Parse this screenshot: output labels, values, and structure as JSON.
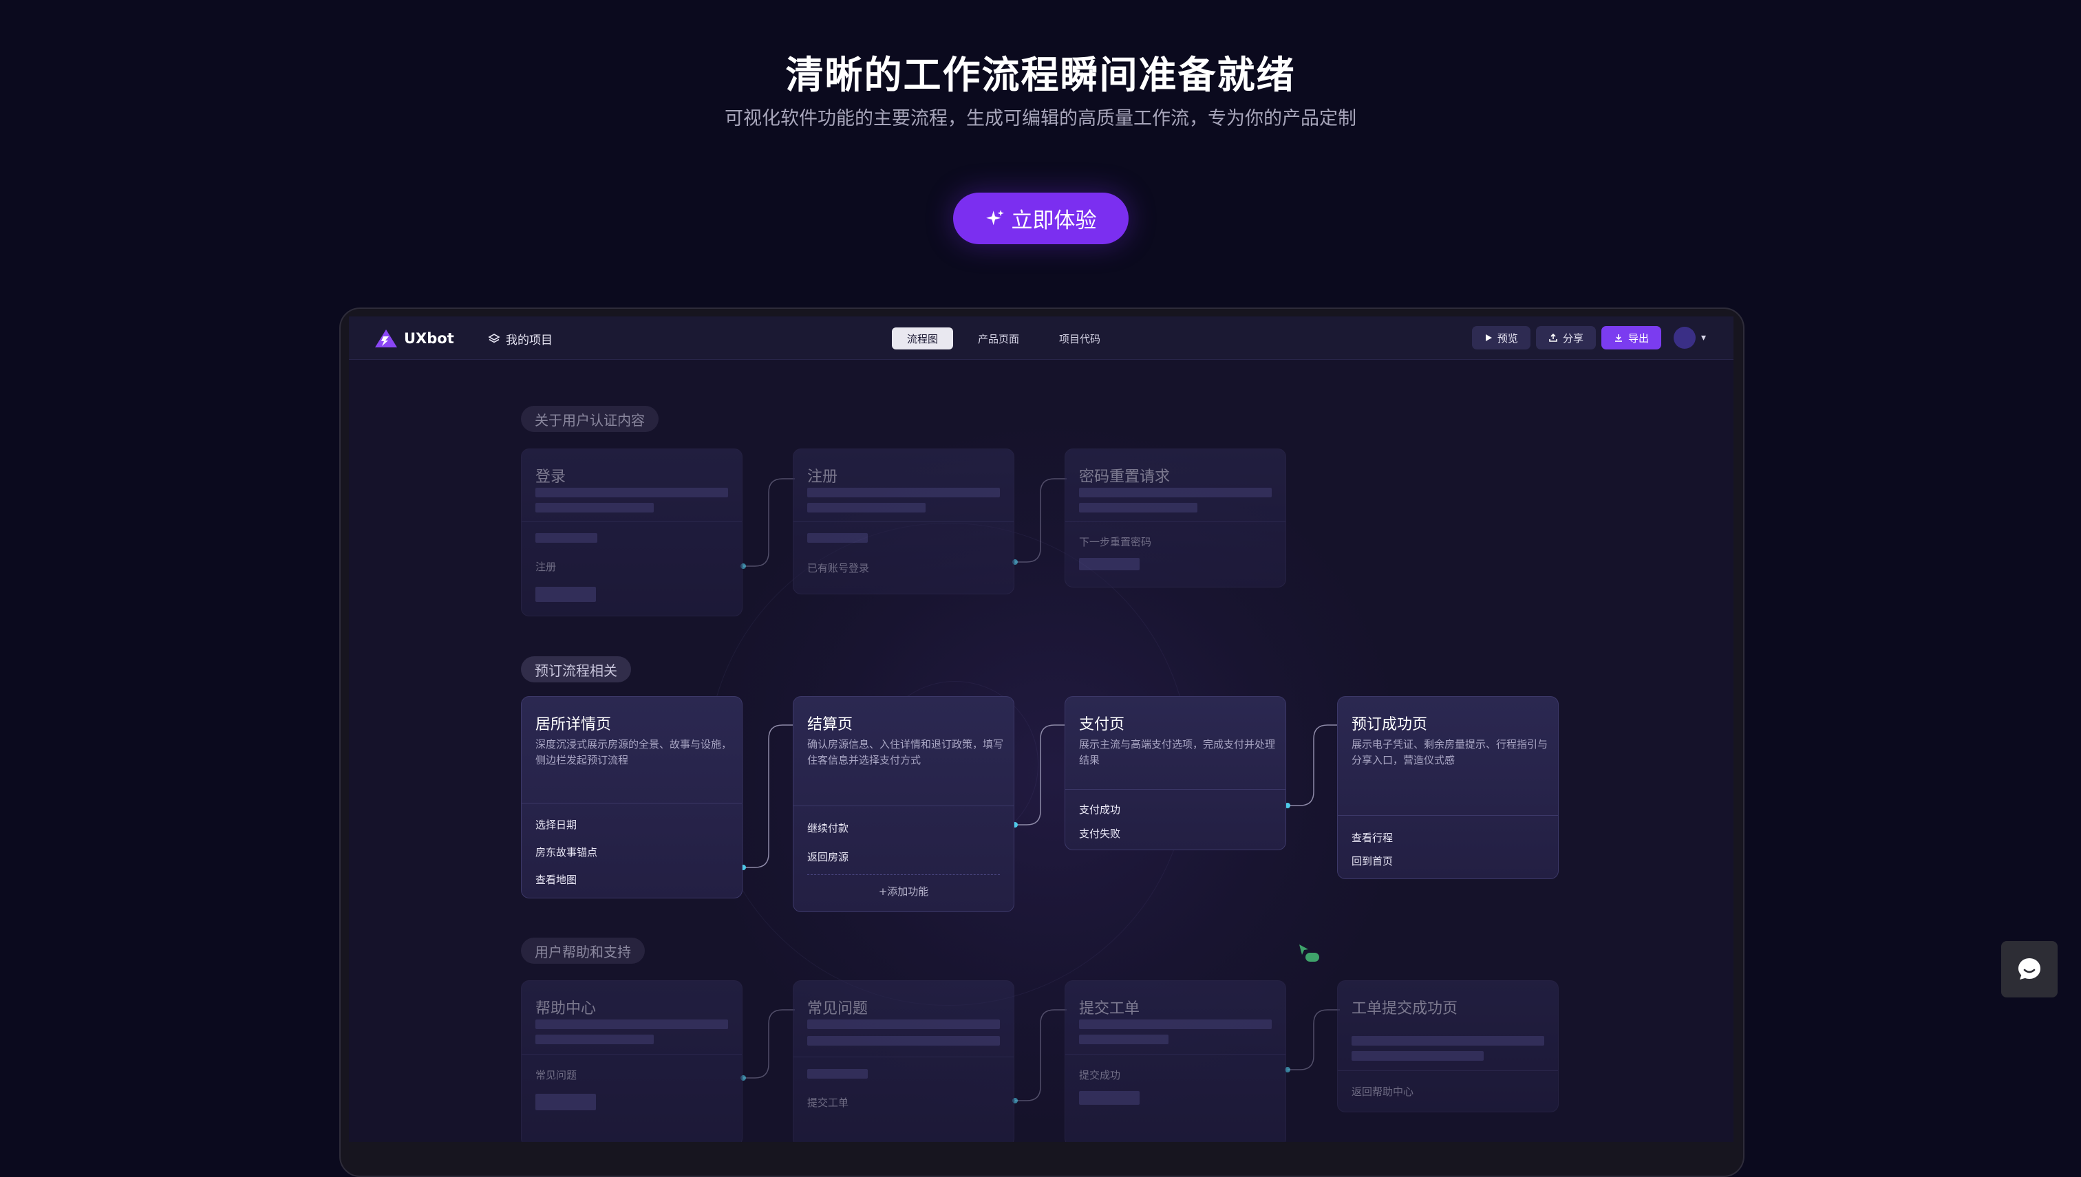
{
  "hero": {
    "title": "清晰的工作流程瞬间准备就绪",
    "subtitle": "可视化软件功能的主要流程，生成可编辑的高质量工作流，专为你的产品定制",
    "cta_label": "立即体验"
  },
  "topbar": {
    "brand": "UXbot",
    "project_label": "我的项目",
    "tabs": [
      "流程图",
      "产品页面",
      "项目代码"
    ],
    "active_tab": "流程图",
    "preview_label": "预览",
    "share_label": "分享",
    "export_label": "导出"
  },
  "groups": {
    "auth": {
      "label": "关于用户认证内容",
      "cards": {
        "login": {
          "title": "登录",
          "item": "注册"
        },
        "register": {
          "title": "注册",
          "item": "已有账号登录"
        },
        "reset": {
          "title": "密码重置请求",
          "item": "下一步重置密码"
        }
      }
    },
    "booking": {
      "label": "预订流程相关",
      "cards": {
        "detail": {
          "title": "居所详情页",
          "desc": "深度沉浸式展示房源的全景、故事与设施，侧边栏发起预订流程",
          "items": [
            "选择日期",
            "房东故事锚点",
            "查看地图"
          ]
        },
        "checkout": {
          "title": "结算页",
          "desc": "确认房源信息、入住详情和退订政策，填写住客信息并选择支付方式",
          "items": [
            "继续付款",
            "返回房源"
          ],
          "add_label": "添加功能"
        },
        "payment": {
          "title": "支付页",
          "desc": "展示主流与高端支付选项，完成支付并处理结果",
          "items": [
            "支付成功",
            "支付失败"
          ]
        },
        "success": {
          "title": "预订成功页",
          "desc": "展示电子凭证、剩余房量提示、行程指引与分享入口，营造仪式感",
          "items": [
            "查看行程",
            "回到首页"
          ]
        }
      }
    },
    "help": {
      "label": "用户帮助和支持",
      "cards": {
        "center": {
          "title": "帮助中心",
          "item": "常见问题"
        },
        "faq": {
          "title": "常见问题",
          "item": "提交工单"
        },
        "ticket": {
          "title": "提交工单",
          "item": "提交成功"
        },
        "done": {
          "title": "工单提交成功页",
          "item": "返回帮助中心"
        }
      }
    }
  },
  "colors": {
    "background": "#0b0a1e",
    "accent": "#7b2ff0",
    "connector": "#4ec9e8"
  }
}
